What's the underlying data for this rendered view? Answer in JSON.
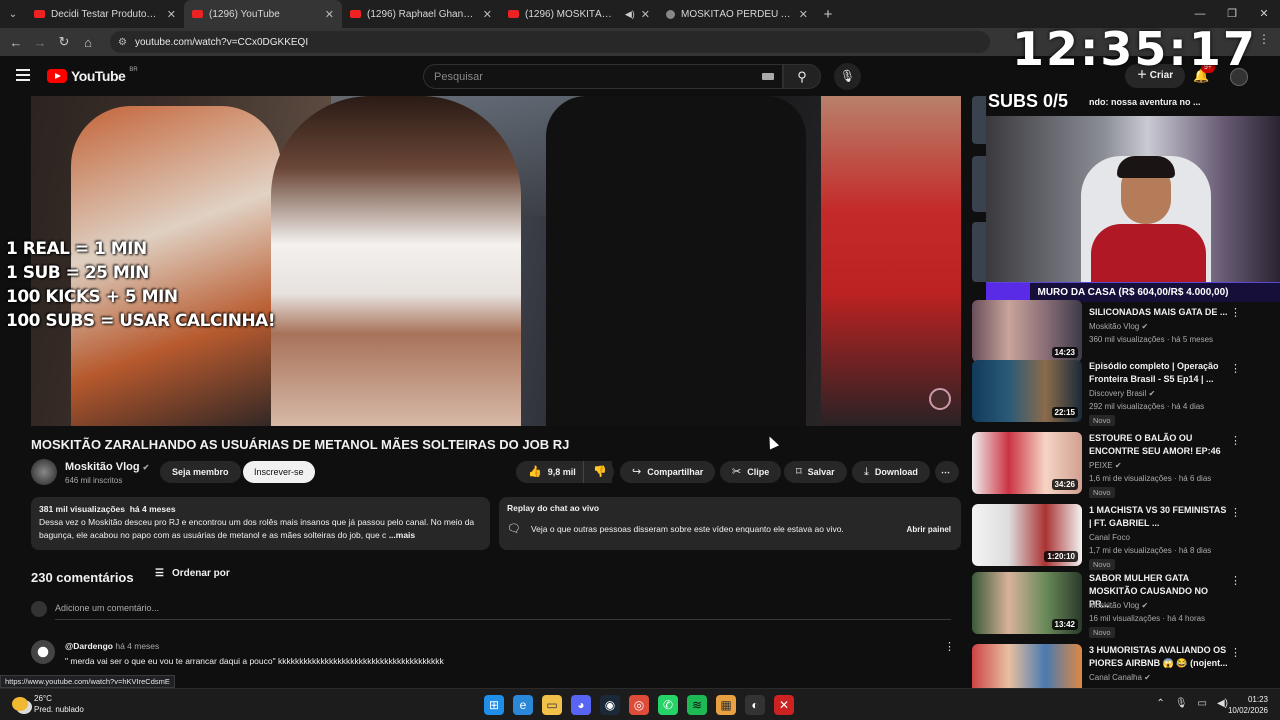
{
  "browser": {
    "tabs": [
      {
        "title": "Decidi Testar Produtos da Shopee",
        "active": false
      },
      {
        "title": "(1296) YouTube",
        "active": true
      },
      {
        "title": "(1296) Raphael Ghanem - YouTube",
        "active": false
      },
      {
        "title": "(1296) MOSKITÃO ZARALHANDO",
        "active": false
      },
      {
        "title": "MOSKITÃO PERDEU A LINHA C",
        "active": false
      }
    ],
    "url": "youtube.com/watch?v=CCx0DGKKEQI"
  },
  "stream_overlay": {
    "clock": "12:35:17",
    "subs_goal": "SUBS 0/5",
    "lines": [
      "1 REAL = 1 MIN",
      "1 SUB = 25 MIN",
      "100 KICKS + 5 MIN",
      "100 SUBS = USAR CALCINHA!"
    ],
    "muro": "MURO DA CASA (R$ 604,00/R$ 4.000,00)"
  },
  "youtube": {
    "logo_country": "BR",
    "search_placeholder": "Pesquisar",
    "create_label": "Criar",
    "notif_badge": "9+"
  },
  "video": {
    "title": "MOSKITÃO ZARALHANDO AS USUÁRIAS DE METANOL MÃES SOLTEIRAS DO JOB RJ",
    "channel": "Moskitão Vlog",
    "subscribers": "646 mil inscritos",
    "join_label": "Seja membro",
    "subscribe_label": "Inscrever-se",
    "likes": "9,8 mil",
    "share_label": "Compartilhar",
    "clip_label": "Clipe",
    "save_label": "Salvar",
    "download_label": "Download",
    "views": "381 mil visualizações",
    "age": "há 4 meses",
    "description": "Dessa vez o Moskitão desceu pro RJ e encontrou um dos rolês mais insanos que já passou pelo canal. No meio da bagunça, ele acabou no papo com as usuárias de metanol e as mães solteiras do job, que c",
    "more_label": "...mais",
    "replay_title": "Replay do chat ao vivo",
    "replay_text": "Veja o que outras pessoas disseram sobre este vídeo enquanto ele estava ao vivo.",
    "replay_button": "Abrir painel"
  },
  "comments": {
    "count": "230 comentários",
    "sort_label": "Ordenar por",
    "add_placeholder": "Adicione um comentário...",
    "items": [
      {
        "user": "@Dardengo",
        "age": "há 4 meses",
        "text": "\" merda vai ser o que eu vou te arrancar daqui a pouco\" kkkkkkkkkkkkkkkkkkkkkkkkkkkkkkkkkkkkkkk"
      }
    ]
  },
  "status_url": "https://www.youtube.com/watch?v=hKVIreCdsmE",
  "sidebar": {
    "top_partial_title": "ndo: nossa aventura no ...",
    "items": [
      {
        "title": "SILICONADAS MAIS GATA DE ...",
        "channel": "Moskitão Vlog",
        "verified": true,
        "meta": "360 mil visualizações · há 5 meses",
        "duration": "14:23",
        "novo": false
      },
      {
        "title": "Episódio completo | Operação Fronteira Brasil - S5 Ep14 | ...",
        "channel": "Discovery Brasil",
        "verified": true,
        "meta": "292 mil visualizações · há 4 dias",
        "duration": "22:15",
        "novo": true
      },
      {
        "title": "ESTOURE O BALÃO OU ENCONTRE SEU AMOR! EP:46",
        "channel": "PEIXE",
        "verified": true,
        "meta": "1,6 mi de visualizações · há 6 dias",
        "duration": "34:26",
        "novo": true
      },
      {
        "title": "1 MACHISTA VS 30 FEMINISTAS | FT. GABRIEL ...",
        "channel": "Canal Foco",
        "verified": false,
        "meta": "1,7 mi de visualizações · há 8 dias",
        "duration": "1:20:10",
        "novo": true
      },
      {
        "title": "SABOR MULHER GATA MOSKITÃO CAUSANDO NO PR...",
        "channel": "Moskitão Vlog",
        "verified": true,
        "meta": "16 mil visualizações · há 4 horas",
        "duration": "13:42",
        "novo": true
      },
      {
        "title": "3 HUMORISTAS AVALIANDO OS PIORES AIRBNB 😱 😂 (nojent...",
        "channel": "Canal Canalha",
        "verified": true,
        "meta": "",
        "duration": "",
        "novo": false
      }
    ],
    "novo_label": "Novo"
  },
  "taskbar": {
    "temp": "26°C",
    "weather": "Pred. nublado",
    "time": "01:23",
    "date": "10/02/2026"
  },
  "colors": {
    "accent_red": "#ff0000",
    "background": "#0f0f0f",
    "card": "#272727"
  }
}
